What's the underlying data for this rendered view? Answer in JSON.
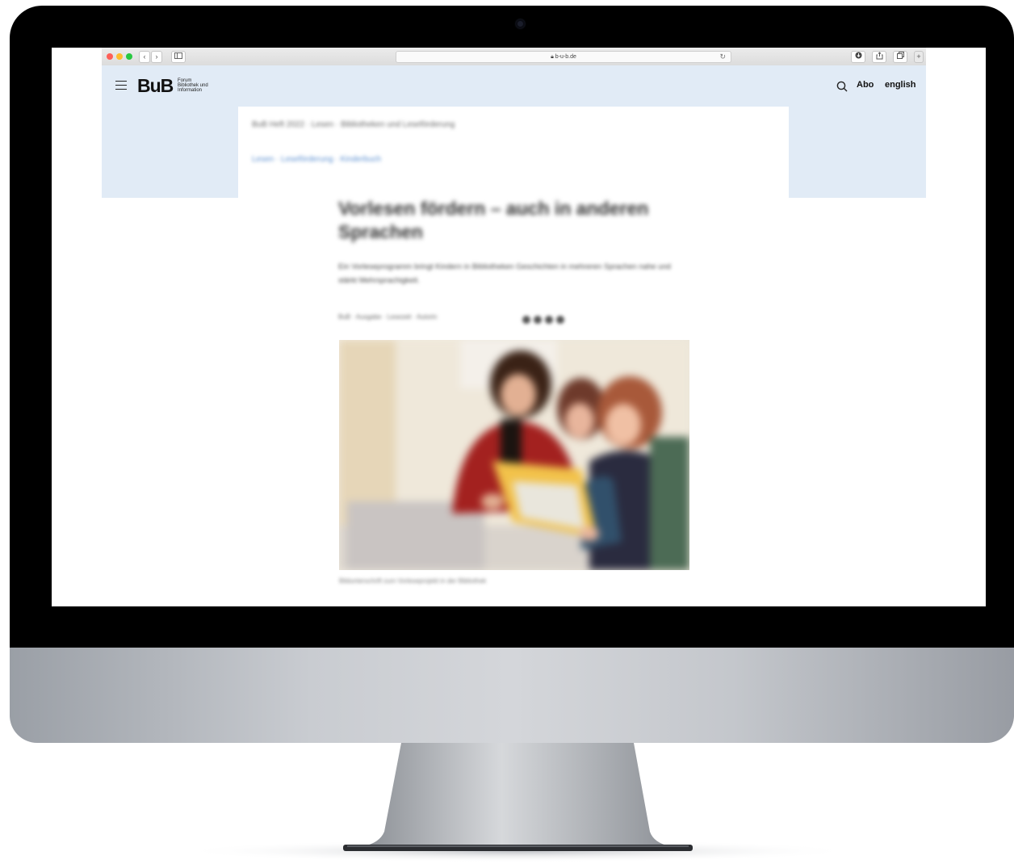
{
  "browser": {
    "url": "b-u-b.de",
    "nav": {
      "back": "‹",
      "forward": "›"
    }
  },
  "site": {
    "logo": "BuB",
    "logo_subtitle": [
      "Forum",
      "Bibliothek und",
      "Information"
    ],
    "nav": {
      "abo": "Abo",
      "language": "english"
    }
  },
  "article": {
    "breadcrumb": "BuB Heft 2022 · Lesen · Bibliotheken und Leseförderung",
    "tags": "Lesen · Leseförderung · Kinderbuch",
    "title": "Vorlesen fördern – auch in anderen Sprachen",
    "lead": "Ein Vorleseprogramm bringt Kindern in Bibliotheken Geschichten in mehreren Sprachen nahe und stärkt Mehrsprachigkeit.",
    "meta": "BuB · Ausgabe · Lesezeit · Autorin",
    "caption": "Bildunterschrift zum Vorleseprojekt in der Bibliothek"
  },
  "colors": {
    "header_bg": "#e1ebf6",
    "traffic_red": "#ff5f57",
    "traffic_yellow": "#febc2e",
    "traffic_green": "#28c840"
  }
}
